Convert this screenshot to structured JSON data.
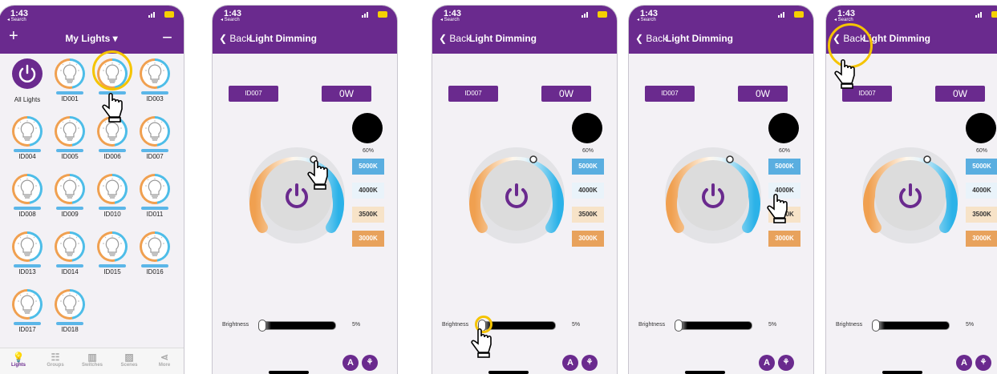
{
  "status": {
    "time": "1:43",
    "search": "◂ Search"
  },
  "lights_screen": {
    "title": "My Lights",
    "add_label": "+",
    "minus_label": "−",
    "lights": [
      {
        "label": "All Lights"
      },
      {
        "label": "ID001"
      },
      {
        "label": ""
      },
      {
        "label": "ID003"
      },
      {
        "label": "ID004"
      },
      {
        "label": "ID005"
      },
      {
        "label": "ID006"
      },
      {
        "label": "ID007"
      },
      {
        "label": "ID008"
      },
      {
        "label": "ID009"
      },
      {
        "label": "ID010"
      },
      {
        "label": "ID011"
      },
      {
        "label": "ID013"
      },
      {
        "label": "ID014"
      },
      {
        "label": "ID015"
      },
      {
        "label": "ID016"
      },
      {
        "label": "ID017"
      },
      {
        "label": "ID018"
      }
    ],
    "tabs": [
      {
        "label": "Lights",
        "icon": "bulb-icon",
        "active": true
      },
      {
        "label": "Groups",
        "icon": "groups-icon"
      },
      {
        "label": "Switches",
        "icon": "switches-icon"
      },
      {
        "label": "Scenes",
        "icon": "scenes-icon"
      },
      {
        "label": "More",
        "icon": "share-icon"
      }
    ]
  },
  "dimming_screen": {
    "back_label": "Back",
    "title": "Light Dimming",
    "device_id": "ID007",
    "power": "0W",
    "level": "60%",
    "color_temps": [
      {
        "label": "5000K",
        "color": "#5aaee0"
      },
      {
        "label": "4000K",
        "color": "#e9f3fa"
      },
      {
        "label": "3500K",
        "color": "#f7e3c8"
      },
      {
        "label": "3000K",
        "color": "#e8a25c"
      }
    ],
    "brightness_label": "Brightness",
    "brightness_value": "5%",
    "auto_label": "A"
  },
  "colors": {
    "brand": "#6a2a8e",
    "highlight": "#f5c400",
    "warm": "#f0a050",
    "cool": "#2bb2e8"
  }
}
